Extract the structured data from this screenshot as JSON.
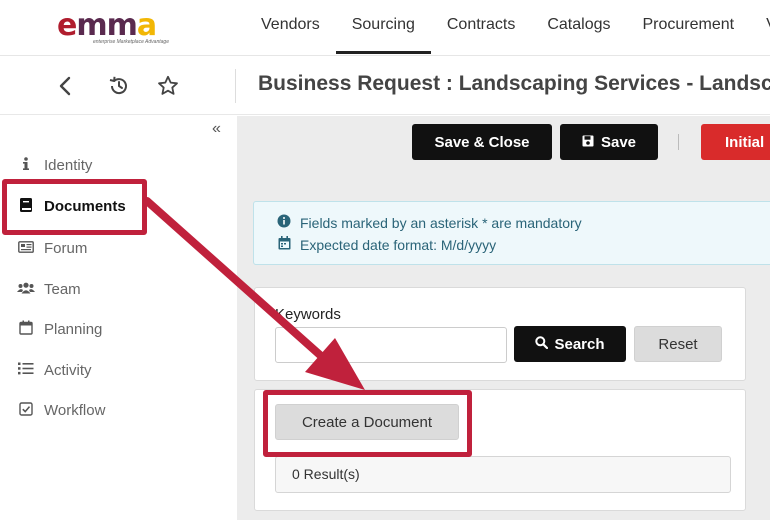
{
  "brand": {
    "logo_name": "emma",
    "logo_parts": [
      "e",
      "mm",
      "a"
    ],
    "tagline": "enterprise Marketplace Advantage",
    "colors": {
      "red": "#b01d2e",
      "plum": "#5a2a4f",
      "gold": "#f2b705"
    }
  },
  "topnav": {
    "tabs": [
      "Vendors",
      "Sourcing",
      "Contracts",
      "Catalogs",
      "Procurement",
      "Vo"
    ],
    "active_index": 1
  },
  "subheader": {
    "title": "Business Request : Landscaping Services - Landscapi",
    "icons": [
      "back-icon",
      "history-icon",
      "star-icon"
    ]
  },
  "sidebar": {
    "collapse_icon": "double-chevron-left-icon",
    "items": [
      {
        "label": "Identity",
        "icon": "info-icon"
      },
      {
        "label": "Documents",
        "icon": "book-icon",
        "active": true
      },
      {
        "label": "Forum",
        "icon": "forum-icon"
      },
      {
        "label": "Team",
        "icon": "users-icon"
      },
      {
        "label": "Planning",
        "icon": "calendar-icon"
      },
      {
        "label": "Activity",
        "icon": "list-icon"
      },
      {
        "label": "Workflow",
        "icon": "check-square-icon"
      }
    ]
  },
  "toolbar": {
    "save_close": "Save & Close",
    "save": "Save",
    "initial": "Initial"
  },
  "notice": {
    "line1": "Fields marked by an asterisk * are mandatory",
    "line2": "Expected date format: M/d/yyyy"
  },
  "search": {
    "label": "Keywords",
    "value": "",
    "search_button": "Search",
    "reset_button": "Reset"
  },
  "documents": {
    "create_button": "Create a Document",
    "results": "0 Result(s)"
  },
  "annotation_color": "#c0213c"
}
